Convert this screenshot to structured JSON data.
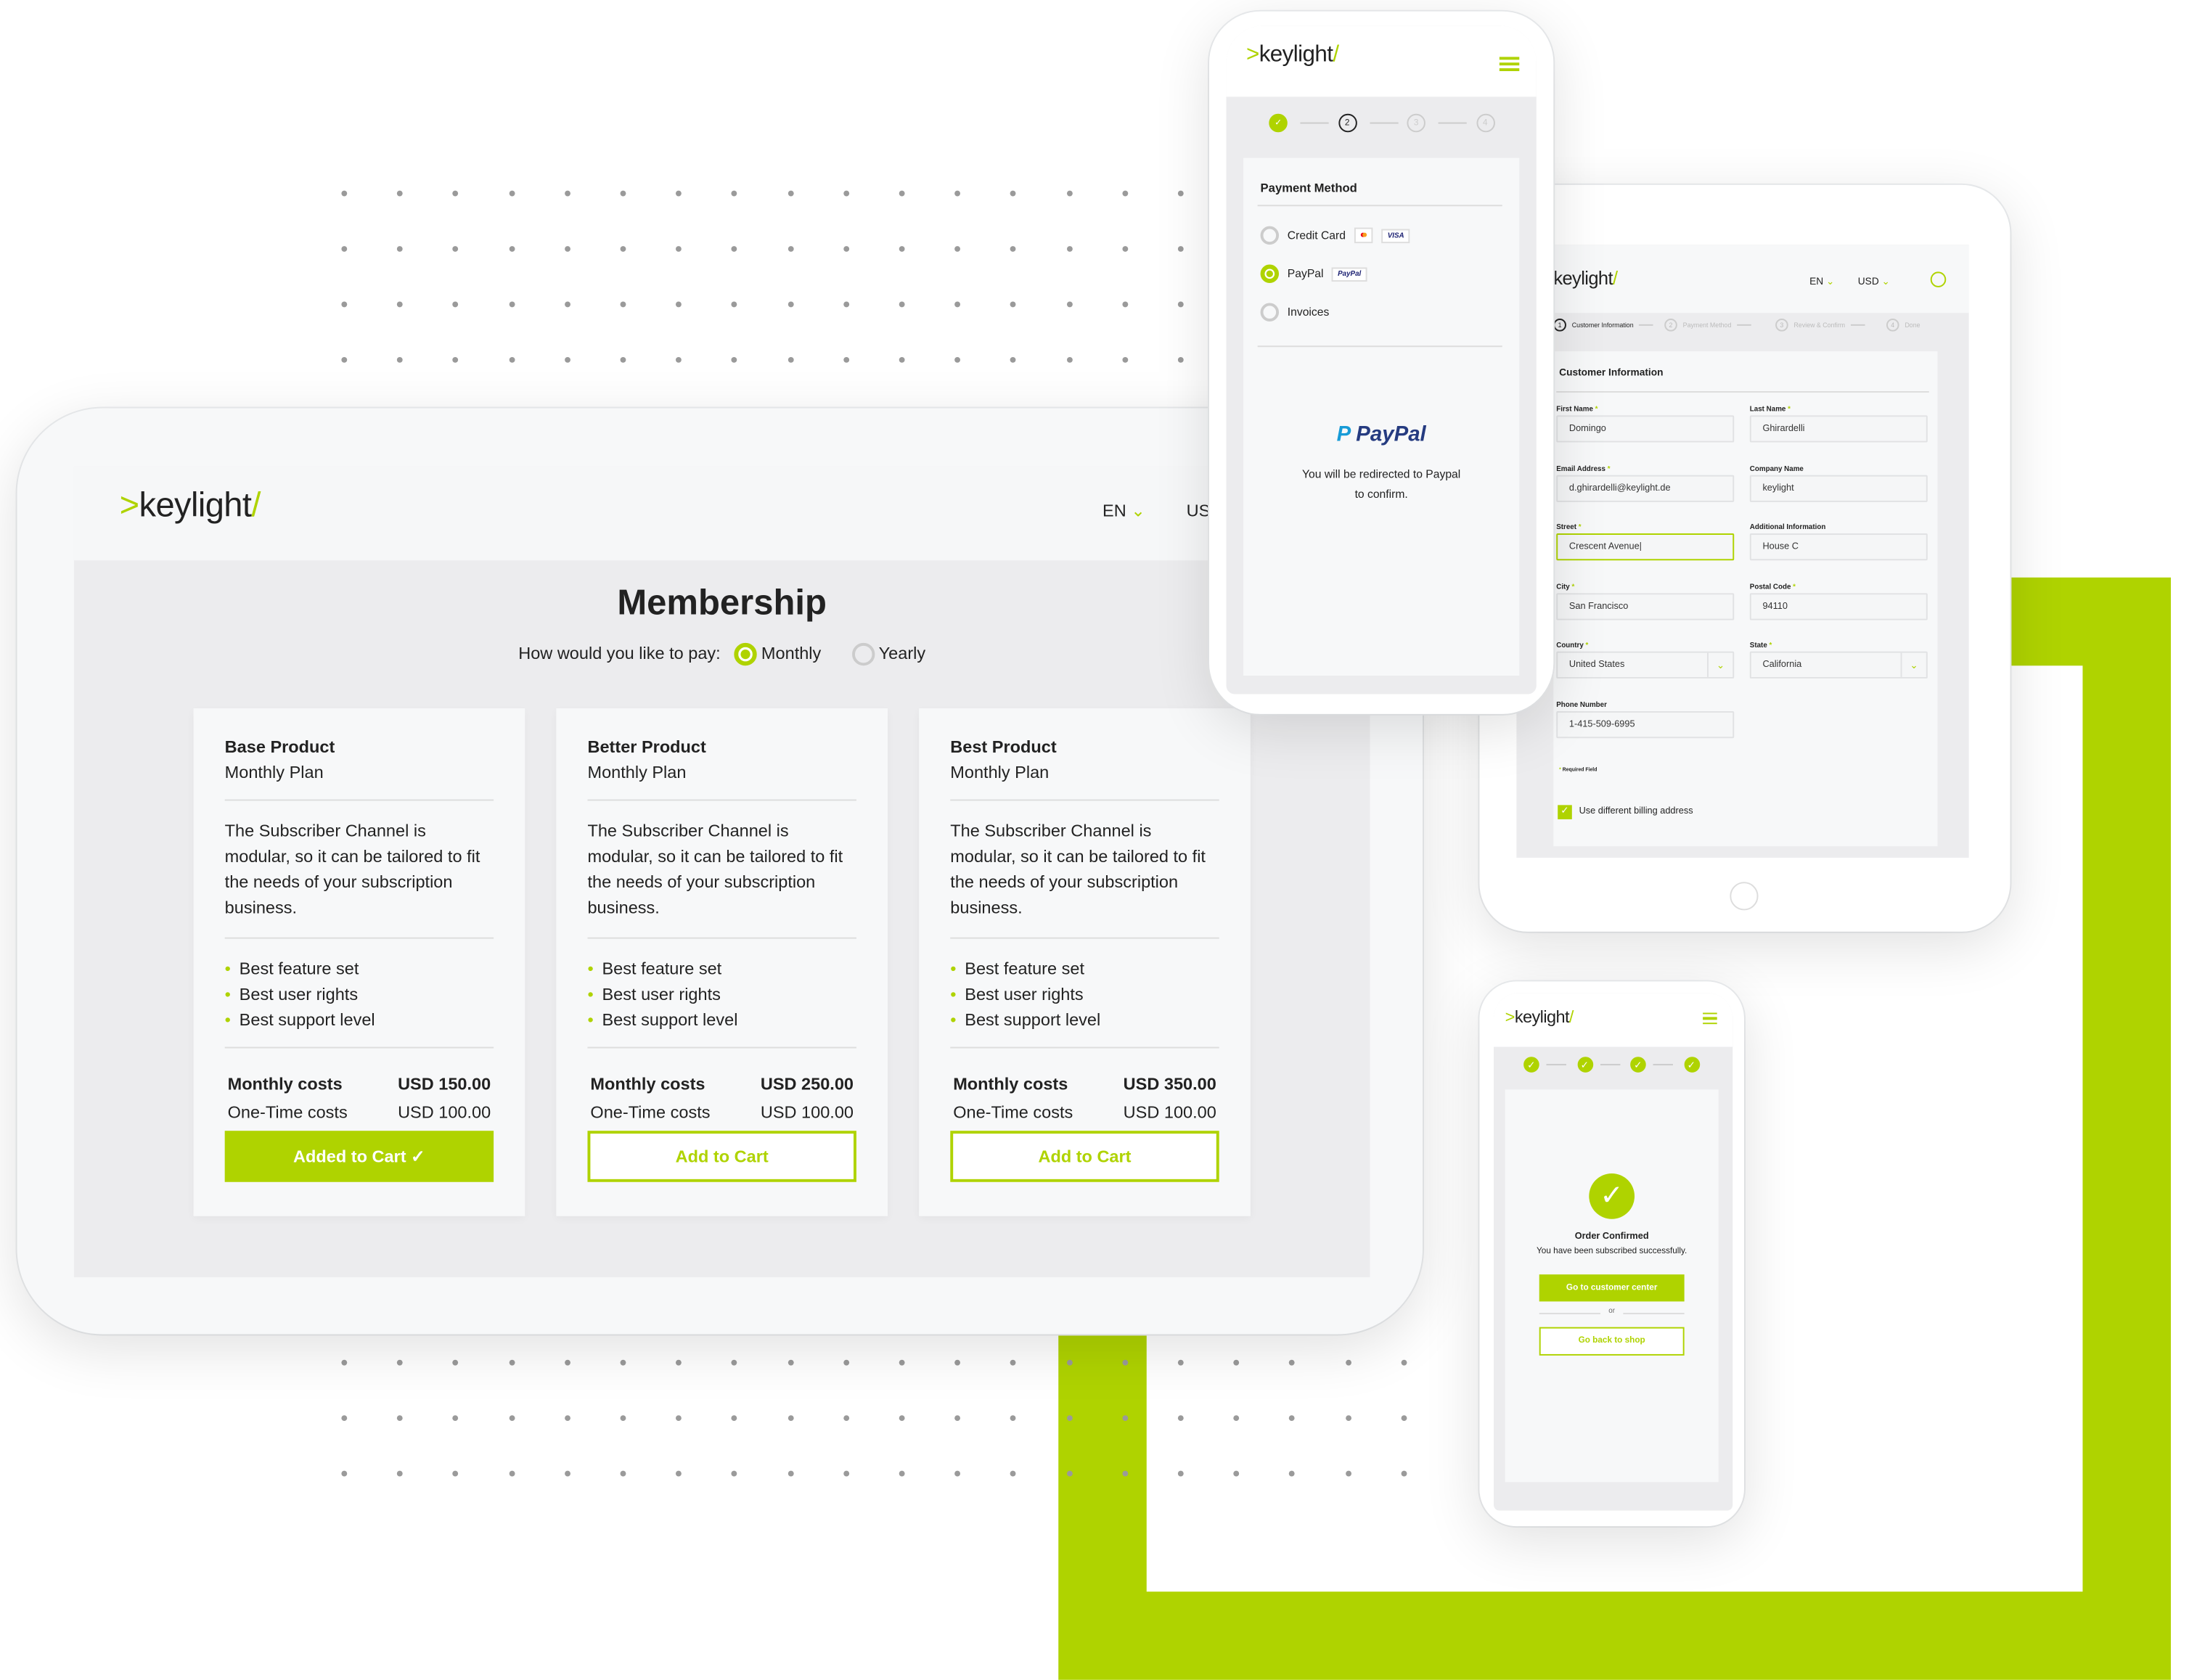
{
  "brand": {
    "logo": ">keylight/",
    "accent": "#afd300"
  },
  "membership": {
    "language": "EN",
    "currency": "US",
    "title": "Membership",
    "pay_prompt": "How would you like to pay:",
    "options": [
      {
        "label": "Monthly",
        "selected": true
      },
      {
        "label": "Yearly",
        "selected": false
      }
    ],
    "plans": [
      {
        "name": "Base Product",
        "period": "Monthly Plan",
        "description": "The Subscriber Channel is modular, so it can be tailored to fit the needs of your subscription business.",
        "features": [
          "Best feature set",
          "Best user rights",
          "Best support level"
        ],
        "monthly_label": "Monthly costs",
        "monthly_price": "USD 150.00",
        "onetime_label": "One-Time costs",
        "onetime_price": "USD 100.00",
        "button": "Added to Cart ✓",
        "in_cart": true
      },
      {
        "name": "Better Product",
        "period": "Monthly Plan",
        "description": "The Subscriber Channel is modular, so it can be tailored to fit the needs of your subscription business.",
        "features": [
          "Best feature set",
          "Best user rights",
          "Best support level"
        ],
        "monthly_label": "Monthly costs",
        "monthly_price": "USD 250.00",
        "onetime_label": "One-Time costs",
        "onetime_price": "USD 100.00",
        "button": "Add to Cart",
        "in_cart": false
      },
      {
        "name": "Best Product",
        "period": "Monthly Plan",
        "description": "The Subscriber Channel is modular, so it can be tailored to fit the needs of your subscription business.",
        "features": [
          "Best feature set",
          "Best user rights",
          "Best support level"
        ],
        "monthly_label": "Monthly costs",
        "monthly_price": "USD 350.00",
        "onetime_label": "One-Time costs",
        "onetime_price": "USD 100.00",
        "button": "Add to Cart",
        "in_cart": false
      }
    ]
  },
  "payment": {
    "steps": [
      "✓",
      "2",
      "3",
      "4"
    ],
    "title": "Payment Method",
    "methods": [
      {
        "label": "Credit Card",
        "badges": [
          "mastercard",
          "VISA"
        ],
        "selected": false
      },
      {
        "label": "PayPal",
        "badges": [
          "PayPal"
        ],
        "selected": true
      },
      {
        "label": "Invoices",
        "badges": [],
        "selected": false
      }
    ],
    "paypal_logo": "PayPal",
    "redirect_text": "You will be redirected to Paypal to confirm."
  },
  "customer": {
    "logo": "keylight/",
    "language": "EN",
    "currency": "USD",
    "steps": [
      {
        "num": "1",
        "label": "Customer Information"
      },
      {
        "num": "2",
        "label": "Payment Method"
      },
      {
        "num": "3",
        "label": "Review & Confirm"
      },
      {
        "num": "4",
        "label": "Done"
      }
    ],
    "title": "Customer Information",
    "fields": {
      "first_name": {
        "label": "First Name",
        "value": "Domingo"
      },
      "last_name": {
        "label": "Last Name",
        "value": "Ghirardelli"
      },
      "email": {
        "label": "Email Address",
        "value": "d.ghirardelli@keylight.de"
      },
      "company": {
        "label": "Company Name",
        "value": "keylight"
      },
      "street": {
        "label": "Street",
        "value": "Crescent Avenue|"
      },
      "additional": {
        "label": "Additional Information",
        "value": "House C"
      },
      "city": {
        "label": "City",
        "value": "San Francisco"
      },
      "postal": {
        "label": "Postal Code",
        "value": "94110"
      },
      "country": {
        "label": "Country",
        "value": "United States"
      },
      "state": {
        "label": "State",
        "value": "California"
      },
      "phone": {
        "label": "Phone Number",
        "value": "1-415-509-6995"
      }
    },
    "required_note": "Required Field",
    "billing_checkbox": {
      "label": "Use different billing address",
      "checked": true
    }
  },
  "confirm": {
    "title": "Order Confirmed",
    "message": "You have been subscribed successfully.",
    "primary_button": "Go to customer center",
    "or": "or",
    "secondary_button": "Go back to shop"
  }
}
